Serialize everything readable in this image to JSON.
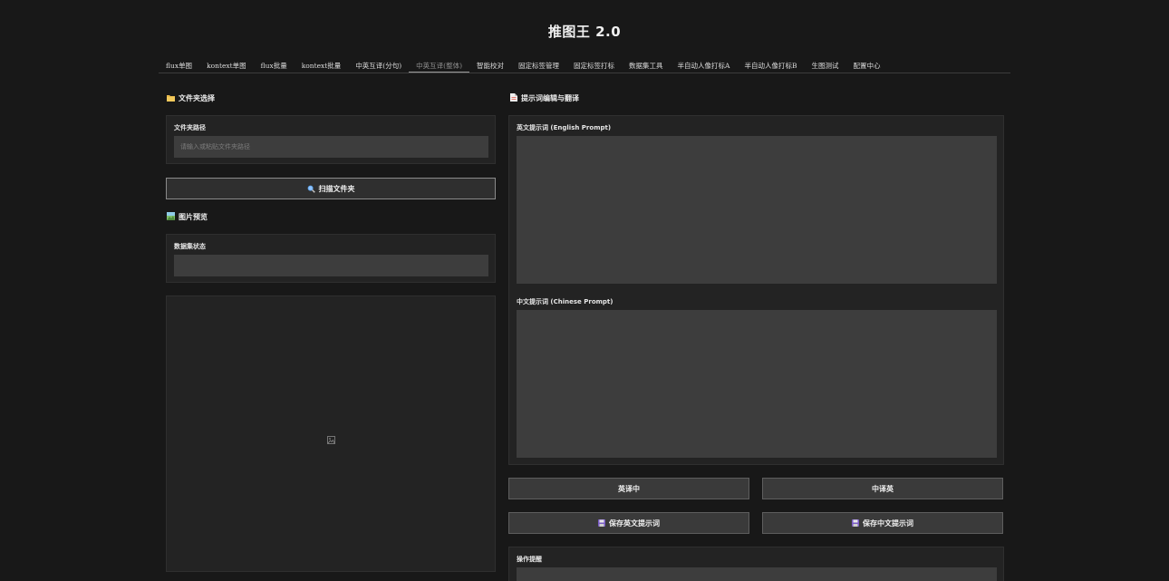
{
  "app": {
    "title": "推图王 2.0"
  },
  "tabs": [
    {
      "label": "flux单图"
    },
    {
      "label": "kontext单图"
    },
    {
      "label": "flux批量"
    },
    {
      "label": "kontext批量"
    },
    {
      "label": "中英互译(分句)"
    },
    {
      "label": "中英互译(整体)",
      "active": true
    },
    {
      "label": "智能校对"
    },
    {
      "label": "固定标签管理"
    },
    {
      "label": "固定标签打标"
    },
    {
      "label": "数据集工具"
    },
    {
      "label": "半自动人像打标A"
    },
    {
      "label": "半自动人像打标B"
    },
    {
      "label": "生图测试"
    },
    {
      "label": "配置中心"
    }
  ],
  "left": {
    "folder_section_title": "文件夹选择",
    "folder_path_label": "文件夹路径",
    "folder_path_placeholder": "请输入或粘贴文件夹路径",
    "folder_path_value": "",
    "scan_button": "扫描文件夹",
    "preview_section_title": "图片预览",
    "dataset_status_label": "数据集状态",
    "dataset_status_value": ""
  },
  "right": {
    "section_title": "提示词编辑与翻译",
    "english_label": "英文提示词 (English Prompt)",
    "english_value": "",
    "chinese_label": "中文提示词 (Chinese Prompt)",
    "chinese_value": "",
    "en_to_zh_button": "英译中",
    "zh_to_en_button": "中译英",
    "save_en_button": "保存英文提示词",
    "save_zh_button": "保存中文提示词",
    "tips_label": "操作提醒"
  },
  "colors": {
    "background": "#181818",
    "panel": "#232323",
    "field": "#3d3d3d",
    "button": "#3a3a3a"
  }
}
